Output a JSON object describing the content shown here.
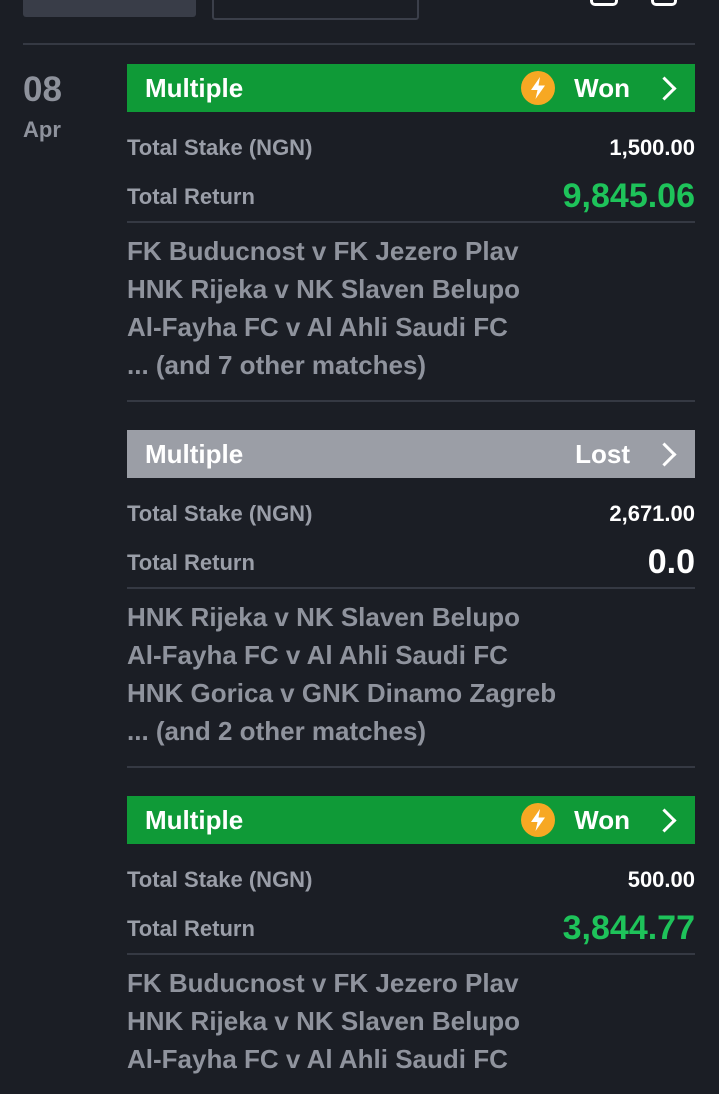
{
  "date": {
    "day": "08",
    "month": "Apr"
  },
  "bets": [
    {
      "type": "Multiple",
      "status": "Won",
      "stake_label": "Total Stake (NGN)",
      "stake": "1,500.00",
      "return_label": "Total Return",
      "return_value": "9,845.06",
      "matches": [
        "FK Buducnost v FK Jezero Plav",
        "HNK Rijeka v NK Slaven Belupo",
        "Al-Fayha FC v Al Ahli Saudi FC",
        "... (and 7 other matches)"
      ]
    },
    {
      "type": "Multiple",
      "status": "Lost",
      "stake_label": "Total Stake (NGN)",
      "stake": "2,671.00",
      "return_label": "Total Return",
      "return_value": "0.0",
      "matches": [
        "HNK Rijeka v NK Slaven Belupo",
        "Al-Fayha FC v Al Ahli Saudi FC",
        "HNK Gorica v GNK Dinamo Zagreb",
        "... (and 2 other matches)"
      ]
    },
    {
      "type": "Multiple",
      "status": "Won",
      "stake_label": "Total Stake (NGN)",
      "stake": "500.00",
      "return_label": "Total Return",
      "return_value": "3,844.77",
      "matches": [
        "FK Buducnost v FK Jezero Plav",
        "HNK Rijeka v NK Slaven Belupo",
        "Al-Fayha FC v Al Ahli Saudi FC"
      ]
    }
  ],
  "icons": {
    "boost": "lightning-bolt-icon",
    "open": "chevron-right-icon"
  },
  "colors": {
    "won": "#0f9a37",
    "lost": "#9b9ea6",
    "return_positive": "#1ec35a",
    "boost": "#f7a823",
    "background": "#1b1e25"
  }
}
